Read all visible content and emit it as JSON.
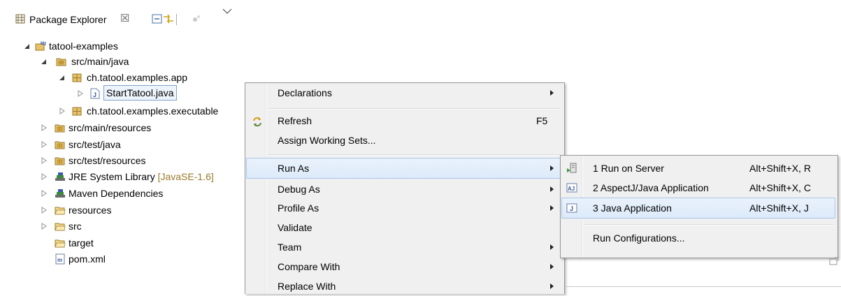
{
  "view": {
    "title": "Package Explorer",
    "close_glyph": "☒"
  },
  "tree": [
    {
      "label": "tatool-examples",
      "icon": "maven-project-icon",
      "twisty": "expanded"
    },
    {
      "label": "src/main/java",
      "icon": "source-folder-icon",
      "twisty": "expanded"
    },
    {
      "label": "ch.tatool.examples.app",
      "icon": "package-icon",
      "twisty": "expanded"
    },
    {
      "label": "StartTatool.java",
      "icon": "java-file-icon",
      "twisty": "collapsed",
      "selected": true
    },
    {
      "label": "ch.tatool.examples.executable",
      "icon": "package-icon",
      "twisty": "collapsed"
    },
    {
      "label": "src/main/resources",
      "icon": "source-folder-icon",
      "twisty": "collapsed"
    },
    {
      "label": "src/test/java",
      "icon": "source-folder-icon",
      "twisty": "collapsed"
    },
    {
      "label": "src/test/resources",
      "icon": "source-folder-icon",
      "twisty": "collapsed"
    },
    {
      "label": "JRE System Library",
      "decoration": "[JavaSE-1.6]",
      "icon": "library-icon",
      "twisty": "collapsed"
    },
    {
      "label": "Maven Dependencies",
      "icon": "library-icon",
      "twisty": "collapsed"
    },
    {
      "label": "resources",
      "icon": "folder-icon",
      "twisty": "collapsed"
    },
    {
      "label": "src",
      "icon": "folder-icon",
      "twisty": "collapsed"
    },
    {
      "label": "target",
      "icon": "folder-icon",
      "twisty": "none"
    },
    {
      "label": "pom.xml",
      "icon": "pom-file-icon",
      "twisty": "none"
    }
  ],
  "context_menu": {
    "items": [
      {
        "label": "Declarations",
        "submenu": true
      },
      {
        "label": "Refresh",
        "accel": "F5",
        "icon": "refresh-icon"
      },
      {
        "label": "Assign Working Sets..."
      },
      {
        "label": "Run As",
        "submenu": true,
        "highlighted": true
      },
      {
        "label": "Debug As",
        "submenu": true
      },
      {
        "label": "Profile As",
        "submenu": true
      },
      {
        "label": "Validate"
      },
      {
        "label": "Team",
        "submenu": true
      },
      {
        "label": "Compare With",
        "submenu": true
      },
      {
        "label": "Replace With",
        "submenu": true
      }
    ]
  },
  "run_as_menu": {
    "items": [
      {
        "label": "1 Run on Server",
        "accel": "Alt+Shift+X, R",
        "icon": "run-on-server-icon"
      },
      {
        "label": "2 AspectJ/Java Application",
        "accel": "Alt+Shift+X, C",
        "icon": "aspectj-icon"
      },
      {
        "label": "3 Java Application",
        "accel": "Alt+Shift+X, J",
        "icon": "java-app-icon",
        "highlighted": true
      },
      {
        "label": "Run Configurations..."
      }
    ]
  },
  "colors": {
    "highlight_border": "#a8c7ec",
    "menu_bg": "#f0f0f0",
    "decoration": "#9a7a2c"
  }
}
